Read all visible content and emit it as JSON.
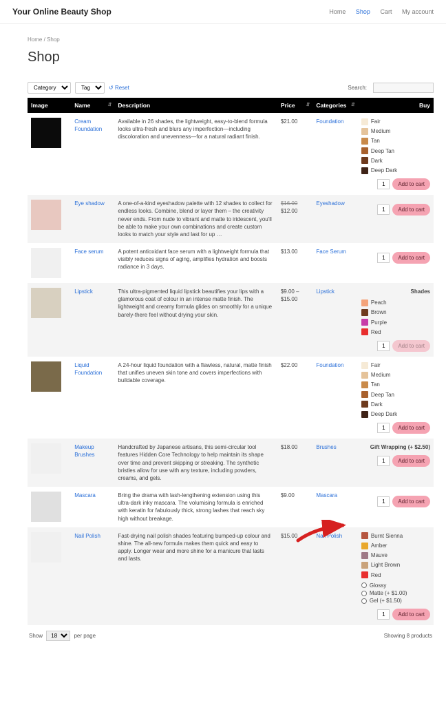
{
  "header": {
    "brand": "Your Online Beauty Shop",
    "nav": {
      "home": "Home",
      "shop": "Shop",
      "cart": "Cart",
      "account": "My account"
    }
  },
  "breadcrumb": {
    "home": "Home",
    "sep": " / ",
    "shop": "Shop"
  },
  "title": "Shop",
  "filters": {
    "category": "Category",
    "tag": "Tag",
    "reset": "Reset",
    "search_label": "Search:"
  },
  "columns": {
    "image": "Image",
    "name": "Name",
    "description": "Description",
    "price": "Price",
    "categories": "Categories",
    "buy": "Buy"
  },
  "qty_default": "1",
  "add_label": "Add to cart",
  "giftwrap_label": "Gift Wrapping (+ $2.50)",
  "shades_title": "Shades",
  "products": [
    {
      "name": "Cream Foundation",
      "desc": "Available in 26 shades, the lightweight, easy-to-blend formula looks ultra-fresh and blurs any imperfection—including discoloration and unevenness—for a natural radiant finish.",
      "price": "$21.00",
      "price_old": "",
      "category": "Foundation",
      "thumb_bg": "#0b0b0b",
      "swatches": [
        {
          "label": "Fair",
          "color": "#f6ead6"
        },
        {
          "label": "Medium",
          "color": "#e5c39a"
        },
        {
          "label": "Tan",
          "color": "#c98a4a"
        },
        {
          "label": "Deep Tan",
          "color": "#a8612d"
        },
        {
          "label": "Dark",
          "color": "#6e3a1d"
        },
        {
          "label": "Deep Dark",
          "color": "#3f2317"
        }
      ]
    },
    {
      "name": "Eye shadow",
      "desc": "A one-of-a-kind eyeshadow palette with 12 shades to collect for endless looks. Combine, blend or layer them – the creativity never ends. From nude to vibrant and matte to iridescent, you'll be able to make your own combinations and create custom looks to match your style and last for up …",
      "price": "$12.00",
      "price_old": "$16.00",
      "category": "Eyeshadow",
      "thumb_bg": "#e8c8c0"
    },
    {
      "name": "Face serum",
      "desc": "A potent antioxidant face serum with a lightweight formula that visibly reduces signs of aging, amplifies hydration and boosts radiance in 3 days.",
      "price": "$13.00",
      "price_old": "",
      "category": "Face Serum",
      "thumb_bg": "#f0f0f0"
    },
    {
      "name": "Lipstick",
      "desc": "This ultra-pigmented liquid lipstick beautifies your lips with a glamorous coat of colour in an intense matte finish. The lightweight and creamy formula glides on smoothly for a unique barely-there feel without drying your skin.",
      "price": "$9.00 – $15.00",
      "price_old": "",
      "category": "Lipstick",
      "thumb_bg": "#d8d0c0",
      "shades_header": true,
      "add_disabled": true,
      "swatches": [
        {
          "label": "Peach",
          "color": "#f4a37a"
        },
        {
          "label": "Brown",
          "color": "#6e3a1d"
        },
        {
          "label": "Purple",
          "color": "#c73ca8"
        },
        {
          "label": "Red",
          "color": "#e82e2e"
        }
      ]
    },
    {
      "name": "Liquid Foundation",
      "desc": "A 24-hour liquid foundation with a flawless, natural, matte finish that unifies uneven skin tone and covers imperfections with buildable coverage.",
      "price": "$22.00",
      "price_old": "",
      "category": "Foundation",
      "thumb_bg": "#7a6a4a",
      "swatches": [
        {
          "label": "Fair",
          "color": "#f6ead6"
        },
        {
          "label": "Medium",
          "color": "#e5c39a"
        },
        {
          "label": "Tan",
          "color": "#c98a4a"
        },
        {
          "label": "Deep Tan",
          "color": "#a8612d"
        },
        {
          "label": "Dark",
          "color": "#6e3a1d"
        },
        {
          "label": "Deep Dark",
          "color": "#3f2317"
        }
      ]
    },
    {
      "name": "Makeup Brushes",
      "desc": "Handcrafted by Japanese artisans, this semi-circular tool features Hidden Core Technology to help maintain its shape over time and prevent skipping or streaking. The synthetic bristles allow for use with any texture, including powders, creams, and gels.",
      "price": "$18.00",
      "price_old": "",
      "category": "Brushes",
      "thumb_bg": "#f0f0f0",
      "giftwrap": true
    },
    {
      "name": "Mascara",
      "desc": "Bring the drama with lash-lengthening extension using this ultra-dark inky mascara. The volumising formula is enriched with keratin for fabulously thick, strong lashes that reach sky high without breakage.",
      "price": "$9.00",
      "price_old": "",
      "category": "Mascara",
      "thumb_bg": "#e0e0e0"
    },
    {
      "name": "Nail Polish",
      "desc": "Fast-drying nail polish shades featuring bumped-up colour and shine. The all-new formula makes them quick and easy to apply. Longer wear and more shine for a manicure that lasts and lasts.",
      "price": "$15.00",
      "price_old": "",
      "category": "Nail Polish",
      "thumb_bg": "#f0f0f0",
      "swatches": [
        {
          "label": "Burnt Sienna",
          "color": "#b5553f"
        },
        {
          "label": "Amber",
          "color": "#e9a82c"
        },
        {
          "label": "Mauve",
          "color": "#9f7986"
        },
        {
          "label": "Light Brown",
          "color": "#c9a27a"
        },
        {
          "label": "Red",
          "color": "#e82e2e"
        }
      ],
      "finishes": [
        {
          "label": "Glossy"
        },
        {
          "label": "Matte (+ $1.00)"
        },
        {
          "label": "Gel (+ $1.50)"
        }
      ]
    }
  ],
  "footer": {
    "show": "Show",
    "perpage": "18",
    "perpage_suffix": "per page",
    "count": "Showing 8 products"
  }
}
